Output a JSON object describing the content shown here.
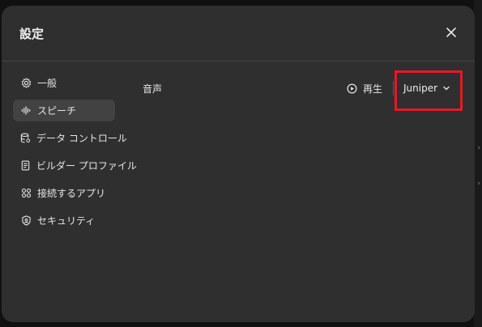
{
  "dialog": {
    "title": "設定",
    "close_icon": "close-icon"
  },
  "sidebar": {
    "items": [
      {
        "label": "一般",
        "icon": "gear-icon",
        "active": false
      },
      {
        "label": "スピーチ",
        "icon": "waveform-icon",
        "active": true
      },
      {
        "label": "データ コントロール",
        "icon": "database-icon",
        "active": false
      },
      {
        "label": "ビルダー プロファイル",
        "icon": "id-card-icon",
        "active": false
      },
      {
        "label": "接続するアプリ",
        "icon": "apps-grid-icon",
        "active": false
      },
      {
        "label": "セキュリティ",
        "icon": "shield-icon",
        "active": false
      }
    ]
  },
  "speech": {
    "voice_label": "音声",
    "play_label": "再生",
    "selected_voice": "Juniper"
  },
  "colors": {
    "modal_bg": "#2f2f2f",
    "active_item_bg": "#424242",
    "highlight": "#e21b23"
  }
}
